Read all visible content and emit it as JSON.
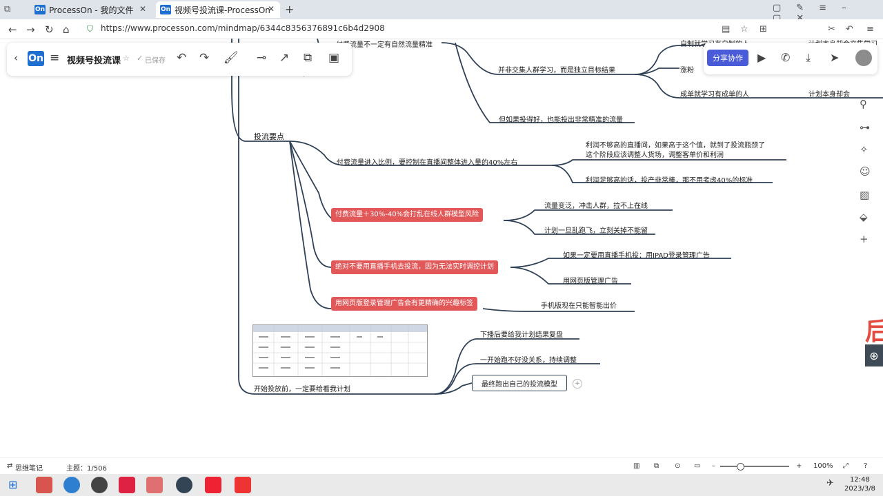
{
  "browser": {
    "tabs": [
      {
        "label": "ProcessOn - 我的文件",
        "favicon": "On"
      },
      {
        "label": "视频号投流课-ProcessOn",
        "favicon": "On"
      }
    ],
    "url": "https://www.processon.com/mindmap/6344c8356376891c6b4d2908"
  },
  "app": {
    "logo": "On",
    "title": "视频号投流课",
    "saved_status": "已保存",
    "share_label": "分享协作",
    "icons": [
      "menu-icon",
      "undo-icon",
      "redo-icon",
      "format-painter-icon",
      "connector-icon",
      "arrow-icon",
      "outline-icon",
      "present-icon"
    ]
  },
  "mindmap": {
    "top_cut": "付费流量不一定有自然流量精准",
    "top_branch": "并非交集人群学习，而是独立目标结果",
    "top_right_1": "自制就学习有自制的人",
    "top_right_1b": "计划本身却会交集学习",
    "top_right_2": "涨粉",
    "top_right_3": "成单就学习有成单的人",
    "top_right_3b": "计划本身却会",
    "good_delivery": "但如果投得好，也能投出非常精准的流量",
    "key_points": "投流要点",
    "ratio": "付费流量进入比例，要控制在直播间整体进入量的40%左右",
    "ratio_a1": "利润不够高的直播间，如果高于这个值，就到了投流瓶颈了",
    "ratio_a2": "这个阶段应该调整人货场，调整客单价和利润",
    "ratio_b": "利润足够高的话，投产非常棒，那不用考虑40%的标准",
    "red1": "付费流量＋30%-40%会打乱在线人群模型风险",
    "red1_a": "流量变泛，冲击人群，拉不上在线",
    "red1_b": "计划一旦乱跑飞，立刻关掉不能留",
    "red2": "绝对不要用直播手机去投流，因为无法实时调控计划",
    "red2_a": "如果一定要用直播手机投：用IPAD登录管理广告",
    "red2_b": "用网页版管理广告",
    "red3": "用网页版登录管理广告会有更精确的兴趣标签",
    "red3_a": "手机版现在只能智能出价",
    "start": "开始投放前，一定要给看我计划",
    "start_a": "下播后要给我计划结果复盘",
    "start_b": "一开始跑不好没关系，持续调整",
    "start_c": "最终跑出自己的投流模型"
  },
  "statusbar": {
    "left": "思维笔记",
    "topics": "主题：1/506",
    "zoom": "100%"
  },
  "clock": {
    "time": "12:48",
    "date": "2023/3/8"
  }
}
